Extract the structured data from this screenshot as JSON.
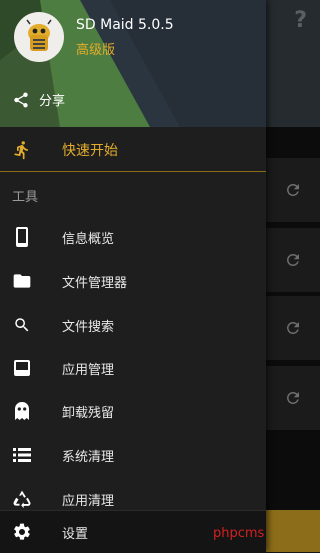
{
  "app": {
    "title": "SD Maid 5.0.5",
    "edition": "高级版",
    "share_label": "分享",
    "quick_start_label": "快速开始",
    "section_tools": "工具",
    "settings_label": "设置"
  },
  "menu": {
    "items": [
      {
        "label": "信息概览",
        "icon": "phone-icon"
      },
      {
        "label": "文件管理器",
        "icon": "folder-icon"
      },
      {
        "label": "文件搜索",
        "icon": "search-icon"
      },
      {
        "label": "应用管理",
        "icon": "app-window-icon"
      },
      {
        "label": "卸载残留",
        "icon": "ghost-icon"
      },
      {
        "label": "系统清理",
        "icon": "list-icon"
      },
      {
        "label": "应用清理",
        "icon": "recycle-icon"
      }
    ]
  },
  "background": {
    "help_icon": "?",
    "watermark": "phpcms",
    "refresh_icons": [
      "refresh-icon",
      "refresh-icon",
      "refresh-icon",
      "refresh-icon"
    ]
  },
  "colors": {
    "accent": "#e3ad2c",
    "drawer_bg": "#1e1e1e",
    "header_green": "#4a7a3d"
  }
}
